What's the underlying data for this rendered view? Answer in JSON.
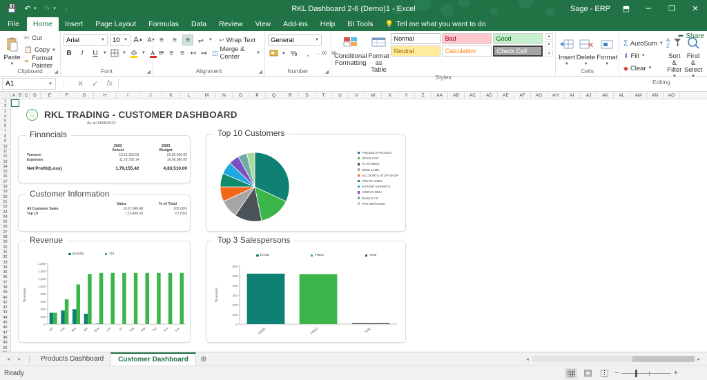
{
  "titlebar": {
    "document_title": "RKL Dashboard 2-6 (Demo)1  -  Excel",
    "user": "Sage - ERP",
    "qat": [
      "save-icon",
      "undo-icon",
      "redo-icon",
      "customize-icon"
    ],
    "minimize": "─",
    "restore": "❐",
    "close": "✕",
    "ribbon_display": "⬒"
  },
  "tabs": {
    "items": [
      "File",
      "Home",
      "Insert",
      "Page Layout",
      "Formulas",
      "Data",
      "Review",
      "View",
      "Add-ins",
      "Help",
      "BI Tools"
    ],
    "active": "Home",
    "tellme": "Tell me what you want to do",
    "share": "Share"
  },
  "ribbon": {
    "clipboard": {
      "title": "Clipboard",
      "paste": "Paste",
      "cut": "Cut",
      "copy": "Copy",
      "format_painter": "Format Painter"
    },
    "font": {
      "title": "Font",
      "font_name": "Arial",
      "font_size": "10",
      "grow": "A",
      "shrink": "A",
      "bold": "B",
      "italic": "I",
      "underline": "U"
    },
    "alignment": {
      "title": "Alignment",
      "wrap_text": "Wrap Text",
      "merge_center": "Merge & Center"
    },
    "number": {
      "title": "Number",
      "format": "General",
      "percent": "%",
      "comma": ","
    },
    "styles": {
      "title": "Styles",
      "conditional_formatting": "Conditional Formatting",
      "format_as_table": "Format as Table",
      "cells": [
        "Normal",
        "Bad",
        "Good",
        "Neutral",
        "Calculation",
        "Check Cell"
      ]
    },
    "cells": {
      "title": "Cells",
      "insert": "Insert",
      "delete": "Delete",
      "format": "Format"
    },
    "editing": {
      "title": "Editing",
      "autosum": "AutoSum",
      "fill": "Fill",
      "clear": "Clear",
      "sort_filter": "Sort & Filter",
      "find_select": "Find & Select"
    }
  },
  "formulabar": {
    "name_box": "A1",
    "cancel": "✕",
    "enter": "✓",
    "insert_function": "fx",
    "value": ""
  },
  "grid": {
    "columns": [
      "A",
      "B",
      "C",
      "D",
      "E",
      "F",
      "G",
      "H",
      "I",
      "J",
      "K",
      "L",
      "M",
      "N",
      "O",
      "P",
      "Q",
      "R",
      "S",
      "T",
      "U",
      "V",
      "W",
      "X",
      "Y",
      "Z",
      "AA",
      "AB",
      "AC",
      "AD",
      "AE",
      "AF",
      "AG",
      "AH",
      "AI",
      "AJ",
      "AK",
      "AL",
      "AM",
      "AN",
      "AO"
    ],
    "active_cell": "A1"
  },
  "dashboard": {
    "title": "RKL TRADING - CUSTOMER DASHBOARD",
    "subtitle": "As at 04/06/2022",
    "logo": "home-icon",
    "financials": {
      "title": "Financials",
      "col_headers": [
        {
          "year": "2003",
          "type": "Actual"
        },
        {
          "year": "2003",
          "type": "Budget"
        }
      ],
      "rows": [
        {
          "label": "Turnover",
          "actual": "13,51,950.56",
          "budget": "20,30,500.00"
        },
        {
          "label": "Expenses",
          "actual": "11,72,795.14",
          "budget": "16,06,990.00"
        }
      ],
      "total": {
        "label": "Net Profit/(Loss)",
        "actual": "1,79,155.42",
        "budget": "4,83,510.00"
      }
    },
    "customer_information": {
      "title": "Customer Information",
      "col_headers": [
        "Value",
        "% of Total"
      ],
      "rows": [
        {
          "label": "All Customer Sales",
          "value": "10,57,848.48",
          "pct": "100.00%"
        },
        {
          "label": "Top 10",
          "value": "7,15,468.00",
          "pct": "67.63%"
        }
      ]
    },
    "top_customers": {
      "title": "Top 10 Customers"
    },
    "revenue": {
      "title": "Revenue"
    },
    "salespersons": {
      "title": "Top 3 Salespersons"
    }
  },
  "chart_data": [
    {
      "type": "pie",
      "title": "Top 10 Customers",
      "labels": [
        "FRICKELS PICKLES",
        "SPICE POT",
        "PL STORES",
        "JENS JAMS",
        "ALL SORTS STOP SHOP",
        "FRUITY JOES",
        "EXPORT EXPERTS",
        "CINDYS DELI",
        "BASILS CC",
        "PKS SERVICES"
      ],
      "values": [
        30.0,
        14.0,
        12.0,
        8.0,
        6.5,
        6.0,
        5.5,
        4.5,
        4.0,
        3.5
      ],
      "colors": [
        "#0e8074",
        "#3cb54a",
        "#4c5358",
        "#a6a6a6",
        "#f4661b",
        "#0f8a6b",
        "#1ea7e0",
        "#7b4fc0",
        "#6fada3",
        "#a9d99b"
      ],
      "legend": "right",
      "start_angle": -90
    },
    {
      "type": "bar",
      "title": "Revenue",
      "categories": [
        "Jan",
        "Feb",
        "Mar",
        "Apr",
        "May",
        "Jun",
        "Jul",
        "Aug",
        "Sep",
        "Oct",
        "Nov",
        "Dec"
      ],
      "series": [
        {
          "name": "Monthly",
          "color": "#0e8074",
          "values": [
            300,
            360,
            395,
            275,
            15,
            0,
            0,
            0,
            0,
            0,
            0,
            0
          ]
        },
        {
          "name": "Ytd",
          "color": "#3cb54a",
          "values": [
            300,
            655,
            1045,
            1325,
            1350,
            1350,
            1350,
            1350,
            1350,
            1350,
            1350,
            1350
          ]
        }
      ],
      "ylabel": "Thousands",
      "ylim": [
        0,
        1600
      ],
      "yticks": [
        "0",
        "200",
        "400",
        "600",
        "800",
        "1,000",
        "1,200",
        "1,400",
        "1,600"
      ],
      "legend": "top",
      "grid": false
    },
    {
      "type": "bar",
      "title": "Top 3 Salespersons",
      "categories": [
        "DAVE",
        "FRED",
        "TOM"
      ],
      "values": [
        523,
        518,
        8
      ],
      "colors": [
        "#0e8074",
        "#3cb54a",
        "#4c5358"
      ],
      "legend_entries": [
        "DAVE",
        "FRED",
        "TOM"
      ],
      "ylabel": "Thousands",
      "ylim": [
        0,
        600
      ],
      "yticks": [
        "0",
        "100",
        "200",
        "300",
        "400",
        "500",
        "600"
      ],
      "legend": "top",
      "grid": false
    }
  ],
  "sheet_tabs": {
    "tabs": [
      "Products Dashboard",
      "Customer Dashboard"
    ],
    "active": "Customer Dashboard",
    "add": "⊕",
    "prev": "◂",
    "next": "▸"
  },
  "statusbar": {
    "status": "Ready",
    "views": [
      "normal-view",
      "page-layout-view",
      "page-break-view"
    ],
    "zoom": "",
    "zoom_out": "−",
    "zoom_in": "+"
  }
}
